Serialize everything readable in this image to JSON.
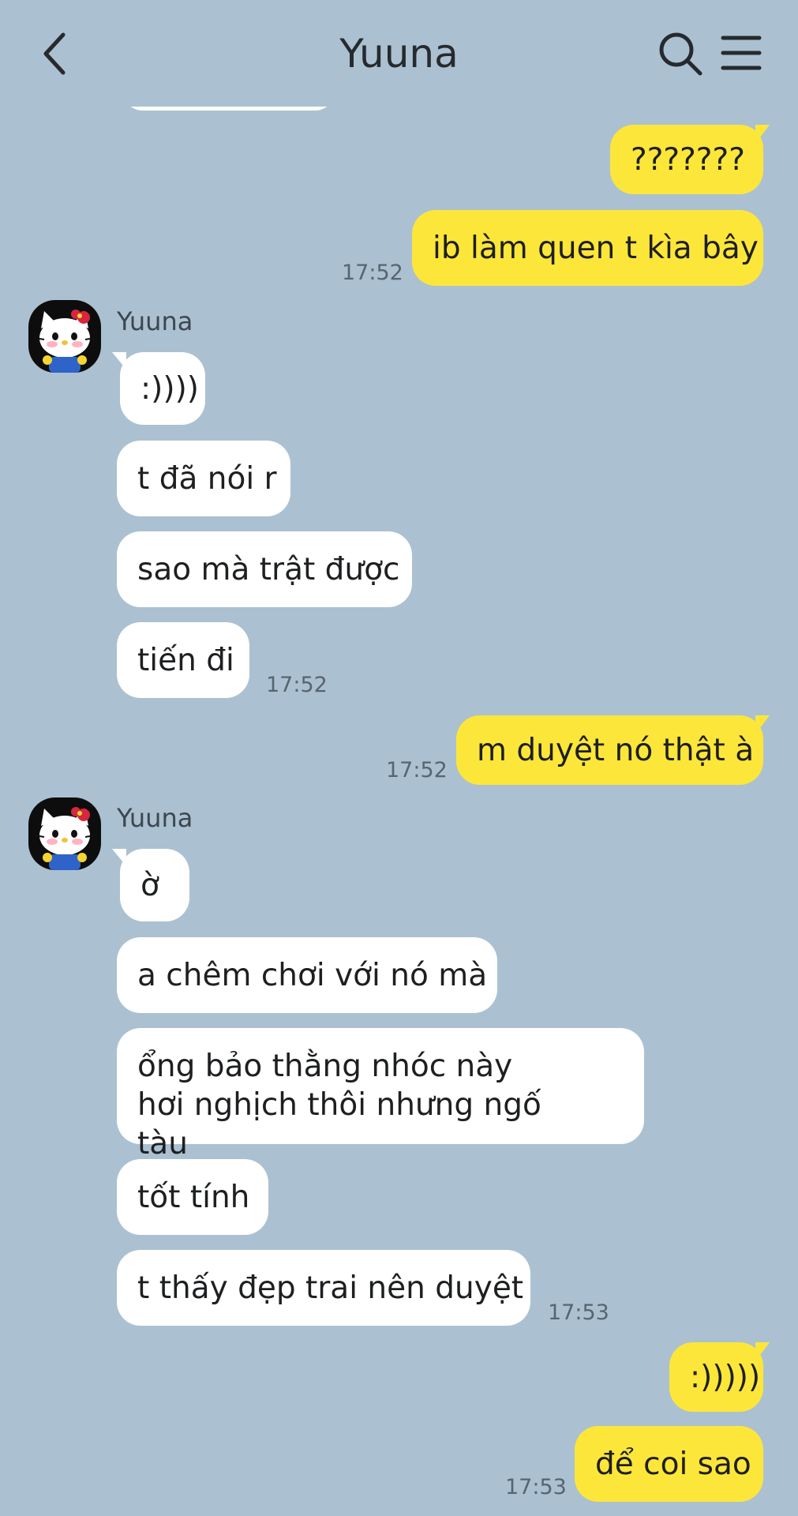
{
  "header": {
    "title": "Yuuna",
    "back_icon": "back-arrow-icon",
    "search_icon": "search-icon",
    "menu_icon": "menu-icon"
  },
  "contact": {
    "name": "Yuuna",
    "avatar_icon": "hello-kitty-avatar"
  },
  "colors": {
    "background": "#abc1d1",
    "outgoing_bubble": "#fde63a",
    "incoming_bubble": "#ffffff",
    "timestamp": "#566570"
  },
  "messages": [
    {
      "side": "out",
      "text": "???????"
    },
    {
      "side": "out",
      "text": "ib làm quen t kìa bây",
      "time": "17:52"
    },
    {
      "side": "in",
      "sender": "Yuuna",
      "text": ":))))"
    },
    {
      "side": "in",
      "text": "t đã nói r"
    },
    {
      "side": "in",
      "text": "sao mà trật được"
    },
    {
      "side": "in",
      "text": "tiến đi",
      "time": "17:52"
    },
    {
      "side": "out",
      "text": "m duyệt nó thật à",
      "time": "17:52"
    },
    {
      "side": "in",
      "sender": "Yuuna",
      "text": "ờ"
    },
    {
      "side": "in",
      "text": "a chêm chơi với nó mà"
    },
    {
      "side": "in",
      "text": "ổng bảo thằng nhóc này hơi nghịch thôi nhưng ngố tàu"
    },
    {
      "side": "in",
      "text": "tốt tính"
    },
    {
      "side": "in",
      "text": "t thấy đẹp trai nên duyệt",
      "time": "17:53"
    },
    {
      "side": "out",
      "text": ":)))))"
    },
    {
      "side": "out",
      "text": "để coi sao",
      "time": "17:53"
    }
  ]
}
